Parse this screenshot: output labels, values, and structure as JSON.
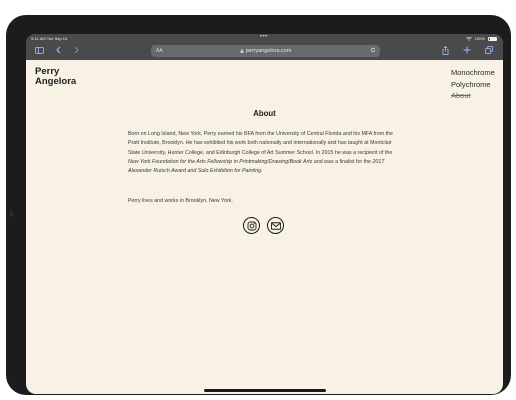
{
  "status_bar": {
    "time_date": "9:41 AM  Tue Sep 14",
    "battery": "100%"
  },
  "toolbar": {
    "reader_label": "AA",
    "url": "perryangelora.com",
    "icons": [
      "sidebar-icon",
      "back-icon",
      "forward-icon",
      "share-icon",
      "new-tab-icon",
      "tabs-icon"
    ]
  },
  "site": {
    "brand_line1": "Perry",
    "brand_line2": "Angelora",
    "nav": [
      "Monochrome",
      "Polychrome",
      "About"
    ],
    "active_nav": "About"
  },
  "about": {
    "heading": "About",
    "p1_a": "Born on Long Island, New York, Perry earned his BFA from the University of Central Florida and his MFA from the Pratt Institute, Brooklyn. He has exhibited his work both nationally and internationally and has taught at Montclair State University, Hunter College, and Edinburgh College of Art Summer School. In 2015 he was a recipient of the ",
    "p1_em1": "New York Foundation for the Arts Fellowship in Printmaking/Drawing/Book Arts",
    "p1_b": " and was a finalist for the ",
    "p1_em2": "2017 Alexander Rutsch Award and Solo Exhibition for Painting.",
    "p2": "Perry lives and works in Brooklyn, New York."
  },
  "social_icons": [
    "instagram-icon",
    "email-icon"
  ],
  "colors": {
    "page_bg": "#f8f1e5",
    "toolbar_bg": "#4a4a4c",
    "accent": "#9ec3ff"
  }
}
